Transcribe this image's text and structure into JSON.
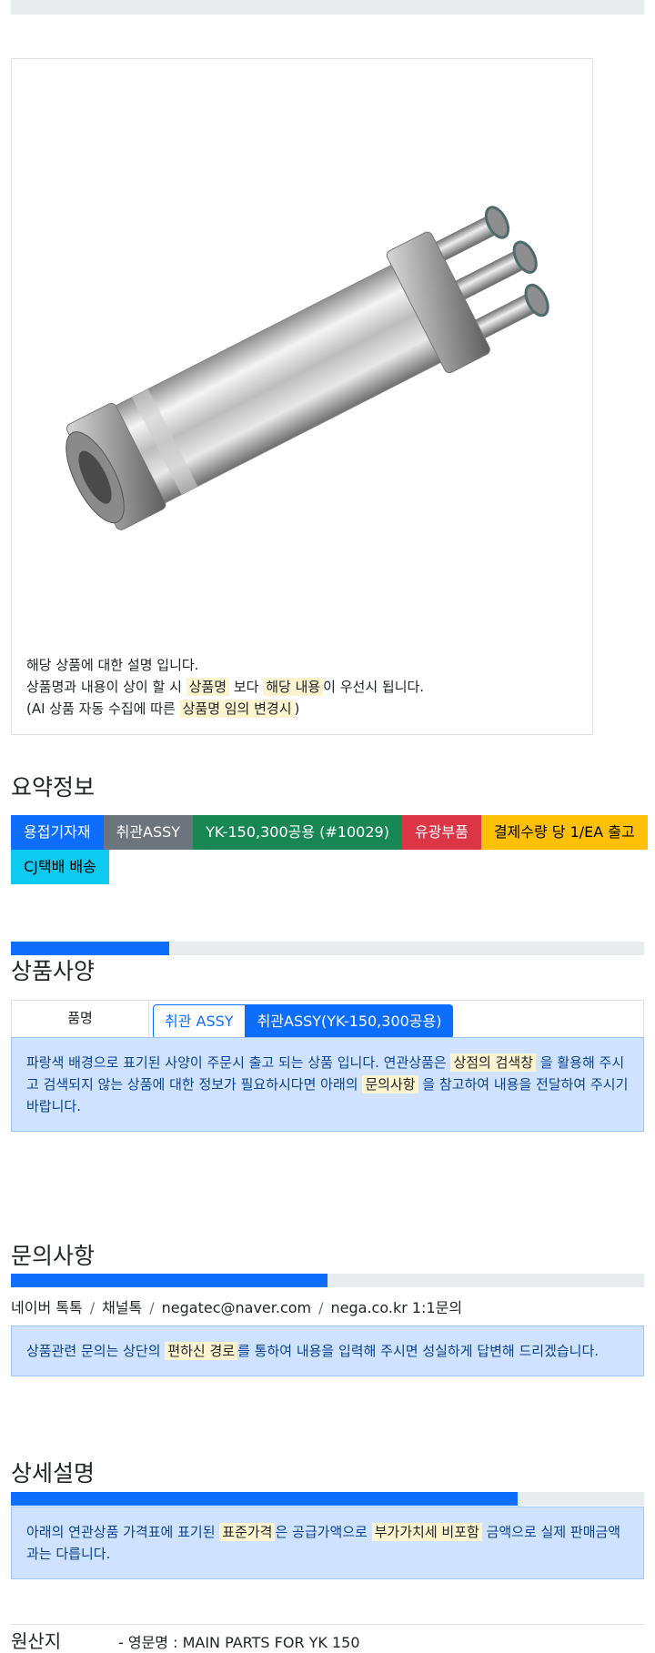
{
  "product": {
    "image_alt": "취관ASSY 제품 사진",
    "desc_line1": "해당 상품에 대한 설명 입니다.",
    "desc_line2_a": "상품명과 내용이 상이 할 시 ",
    "desc_line2_mark1": "상품명",
    "desc_line2_b": " 보다 ",
    "desc_line2_mark2": "해당 내용",
    "desc_line2_c": "이 우선시 됩니다.",
    "desc_line3_a": "(AI 상품 자동 수집에 따른 ",
    "desc_line3_mark": "상품명 임의 변경시",
    "desc_line3_b": ")"
  },
  "summary": {
    "title": "요약정보",
    "badges": [
      "용접기자재",
      "취관ASSY",
      "YK-150,300공용 (#10029)",
      "유광부품",
      "결제수량 당 1/EA 출고",
      "CJ택배 배송"
    ],
    "colors": {
      "blue": "#0d6efd",
      "gray": "#6c757d",
      "green": "#198754",
      "red": "#dc3545",
      "yellow": "#ffc107",
      "cyan": "#0dcaf0"
    }
  },
  "spec": {
    "progress": 0.25,
    "title": "상품사양",
    "row_label": "품명",
    "options": [
      "취관 ASSY",
      "취관ASSY(YK-150,300공용)"
    ],
    "notice_a": "파랑색 배경으로 표기된 사양이 주문시 출고 되는 상품 입니다. 연관상품은 ",
    "notice_mark1": "상점의 검색창",
    "notice_b": " 을 활용해 주시고 검색되지 않는 상품에 대한 정보가 필요하시다면 아래의 ",
    "notice_mark2": "문의사항",
    "notice_c": " 을 참고하여 내용을 전달하여 주시기 바랍니다."
  },
  "inquiry": {
    "title": "문의사항",
    "progress": 0.5,
    "channels": [
      "네이버 톡톡",
      "채널톡",
      "negatec@naver.com",
      "nega.co.kr 1:1문의"
    ],
    "separator": "/",
    "notice_a": "상품관련 문의는 상단의 ",
    "notice_mark": "편하신 경로",
    "notice_b": "를 통하여 내용을 입력해 주시면 성실하게 답변해 드리겠습니다."
  },
  "detail": {
    "title": "상세설명",
    "progress": 0.8,
    "notice_a": "아래의 연관상품 가격표에 표기된 ",
    "notice_mark1": "표준가격",
    "notice_b": "은 공급가액으로 ",
    "notice_mark2": "부가가치세 비포함",
    "notice_c": " 금액으로 실제 판매금액과는 다릅니다."
  },
  "origin": {
    "label": "원산지",
    "value": "- 영문명 : MAIN PARTS FOR YK 150"
  }
}
